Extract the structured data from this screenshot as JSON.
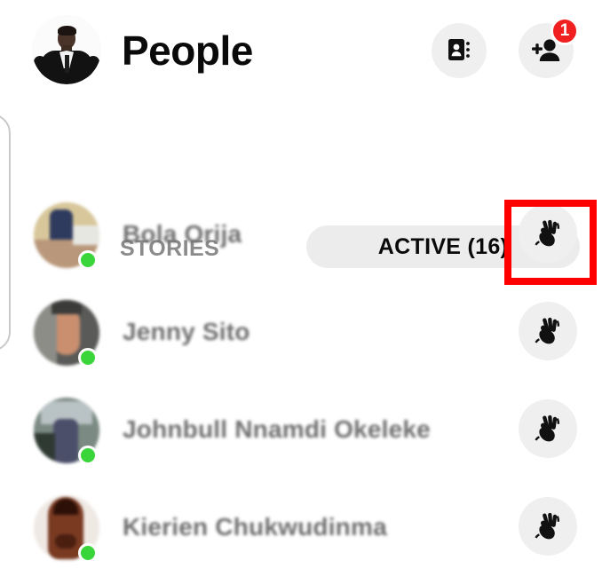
{
  "header": {
    "title": "People",
    "avatar_alt": "user-profile-photo",
    "contacts_button_label": "contacts-book",
    "add_person_button_label": "add-person",
    "add_person_badge": "1"
  },
  "tabs": [
    {
      "id": "stories",
      "label": "STORIES",
      "selected": false
    },
    {
      "id": "active",
      "label": "ACTIVE (16)",
      "selected": true
    }
  ],
  "people": [
    {
      "name": "Bola Orija",
      "status": "active",
      "wave_label": "wave",
      "highlighted": true,
      "avatar_colors": [
        "#d8c79a",
        "#2f3b5e",
        "#b9977a",
        "#e7e7e2"
      ]
    },
    {
      "name": "Jenny Sito",
      "status": "active",
      "wave_label": "wave",
      "highlighted": false,
      "avatar_colors": [
        "#5a5a58",
        "#c98f6f",
        "#8d8d88",
        "#3b3b39"
      ]
    },
    {
      "name": "Johnbull Nnamdi Okeleke",
      "status": "active",
      "wave_label": "wave",
      "highlighted": false,
      "avatar_colors": [
        "#7b8a83",
        "#4c4f6a",
        "#b9c2c4",
        "#2f3a33"
      ]
    },
    {
      "name": "Kierien Chukwudinma",
      "status": "active",
      "wave_label": "wave",
      "highlighted": false,
      "avatar_colors": [
        "#7a3a22",
        "#4a1f10",
        "#a85c33",
        "#2d1008"
      ]
    }
  ],
  "colors": {
    "badge_red": "#f02020",
    "presence_green": "#3ad53a",
    "highlight_red": "#ff0000",
    "pill_gray": "#ececec",
    "icon_circle_gray": "#efefef",
    "muted_text": "#8b8b8b"
  }
}
